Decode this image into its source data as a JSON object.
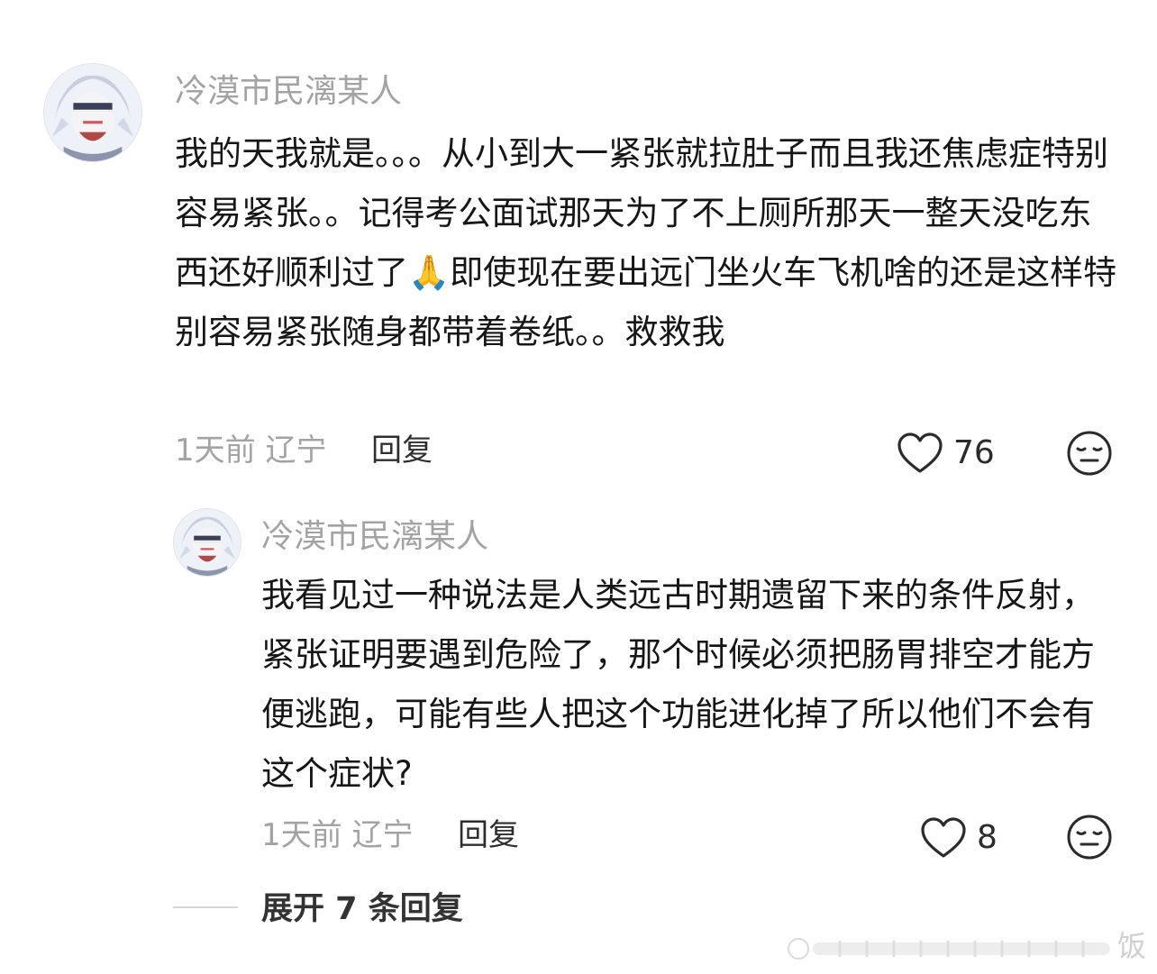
{
  "comment": {
    "username": "冷漠市民漓某人",
    "text": "我的天我就是。。。从小到大一紧张就拉肚子而且我还焦虑症特别容易紧张。。记得考公面试那天为了不上厕所那天一整天没吃东西还好顺利过了🙏即使现在要出远门坐火车飞机啥的还是这样特别容易紧张随身都带着卷纸。。救救我",
    "meta": "1天前 辽宁",
    "reply_label": "回复",
    "like_count": "76",
    "like_icon": "heart-outline",
    "emoji_icon": "neutral-face"
  },
  "reply": {
    "username": "冷漠市民漓某人",
    "text": "我看见过一种说法是人类远古时期遗留下来的条件反射，紧张证明要遇到危险了，那个时候必须把肠胃排空才能方便逃跑，可能有些人把这个功能进化掉了所以他们不会有这个症状?",
    "meta": "1天前 辽宁",
    "reply_label": "回复",
    "like_count": "8",
    "like_icon": "heart-outline",
    "emoji_icon": "neutral-face"
  },
  "expand": {
    "label": "展开 7 条回复"
  },
  "watermark": {
    "char": "饭"
  },
  "colors": {
    "username": "#a3a3a3",
    "text": "#161616",
    "meta": "#a3a3a3",
    "icon": "#2b2b2b"
  }
}
